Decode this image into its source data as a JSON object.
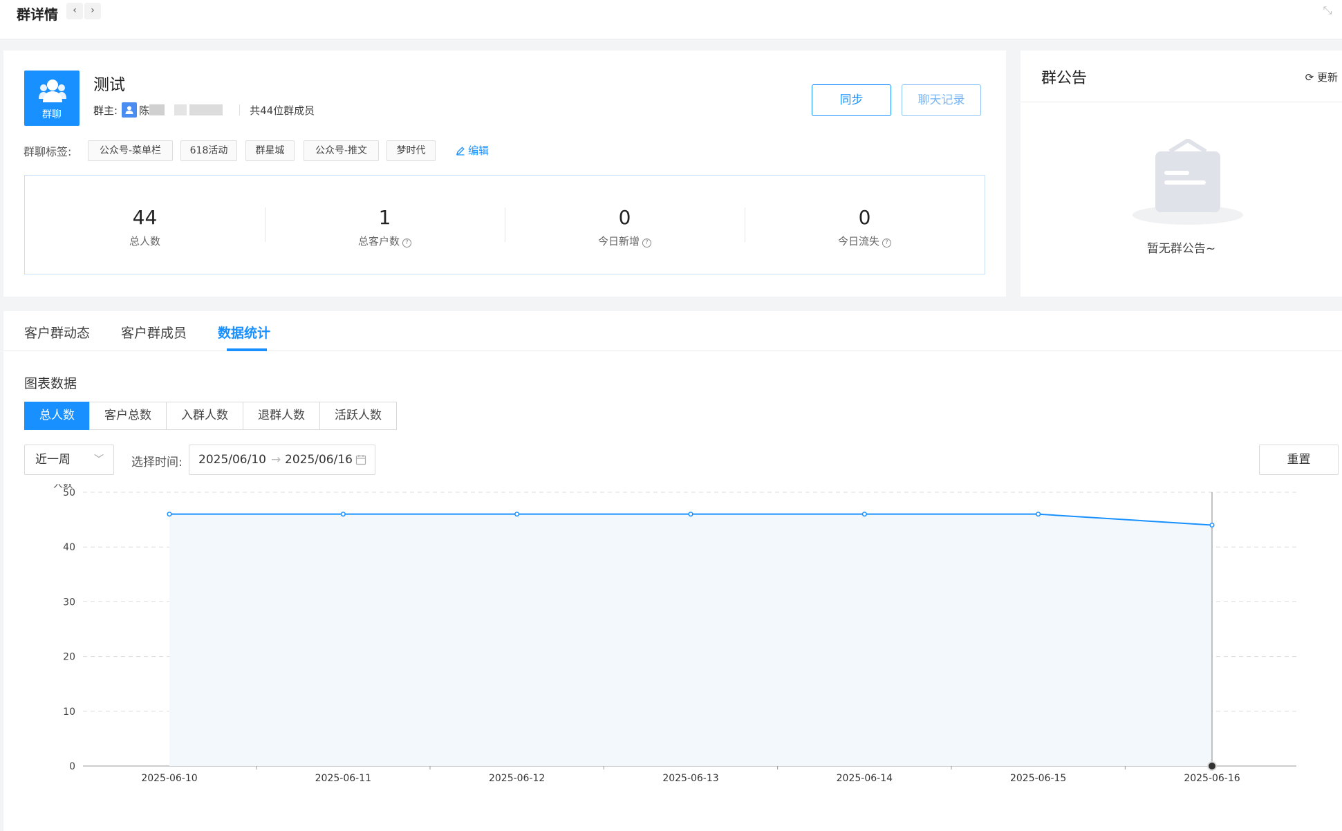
{
  "header": {
    "title": "群详情",
    "prev": "‹",
    "next": "›"
  },
  "group": {
    "avatar_label": "群聊",
    "name": "测试",
    "owner_label": "群主:",
    "owner_name": "陈",
    "member_count_text": "共44位群成员",
    "buttons": {
      "sync": "同步",
      "chat_history": "聊天记录"
    },
    "tags_label": "群聊标签:",
    "tags": [
      "公众号-菜单栏",
      "618活动",
      "群星城",
      "公众号-推文",
      "梦时代"
    ],
    "edit_label": "编辑"
  },
  "stats": [
    {
      "value": "44",
      "label": "总人数",
      "help": false
    },
    {
      "value": "1",
      "label": "总客户数",
      "help": true
    },
    {
      "value": "0",
      "label": "今日新增",
      "help": true
    },
    {
      "value": "0",
      "label": "今日流失",
      "help": true
    }
  ],
  "notice": {
    "title": "群公告",
    "refresh": "更新",
    "empty": "暂无群公告~"
  },
  "tabs": [
    {
      "label": "客户群动态",
      "active": false
    },
    {
      "label": "客户群成员",
      "active": false
    },
    {
      "label": "数据统计",
      "active": true
    }
  ],
  "section_title": "图表数据",
  "metric_tabs": [
    {
      "label": "总人数",
      "active": true
    },
    {
      "label": "客户总数",
      "active": false
    },
    {
      "label": "入群人数",
      "active": false
    },
    {
      "label": "退群人数",
      "active": false
    },
    {
      "label": "活跃人数",
      "active": false
    }
  ],
  "filters": {
    "period": "近一周",
    "time_label": "选择时间:",
    "start_date": "2025/06/10",
    "range_sep": "→",
    "end_date": "2025/06/16",
    "reset": "重置"
  },
  "colors": {
    "primary": "#1890ff",
    "area_fill": "#f3f8fd",
    "grid": "#dcdcdc"
  },
  "chart_data": {
    "type": "area",
    "title": "",
    "ylabel": "人数",
    "xlabel": "",
    "x": [
      "2025-06-10",
      "2025-06-11",
      "2025-06-12",
      "2025-06-13",
      "2025-06-14",
      "2025-06-15",
      "2025-06-16"
    ],
    "series": [
      {
        "values": [
          46,
          46,
          46,
          46,
          46,
          46,
          44
        ]
      }
    ],
    "ylim": [
      0,
      50
    ],
    "yticks": [
      0,
      10,
      20,
      30,
      40,
      50
    ],
    "grid": true,
    "legend": "none",
    "highlight_index": 6
  }
}
